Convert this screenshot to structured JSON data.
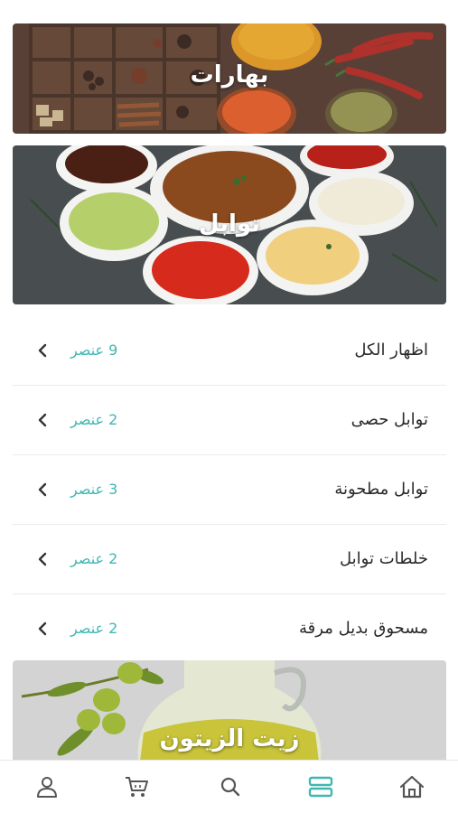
{
  "banners": {
    "spices_title": "بهارات",
    "seasonings_title": "توابل",
    "olive_oil_title": "زيت الزيتون"
  },
  "subcategories": [
    {
      "label": "اظهار الكل",
      "count": "9 عنصر"
    },
    {
      "label": "توابل حصى",
      "count": "2 عنصر"
    },
    {
      "label": "توابل مطحونة",
      "count": "3 عنصر"
    },
    {
      "label": "خلطات توابل",
      "count": "2 عنصر"
    },
    {
      "label": "مسحوق بديل مرقة",
      "count": "2 عنصر"
    }
  ],
  "navbar": {
    "items": [
      "profile-icon",
      "cart-icon",
      "search-icon",
      "categories-icon",
      "home-icon"
    ],
    "active": "categories-icon"
  },
  "colors": {
    "accent": "#3fb8b3",
    "label": "#2a2a2a",
    "icon": "#555555"
  }
}
